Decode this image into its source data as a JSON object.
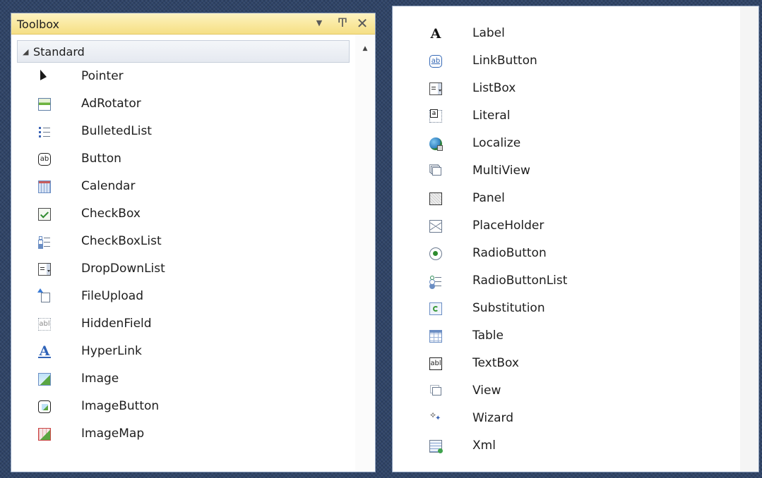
{
  "toolbox": {
    "title": "Toolbox",
    "dropdown_glyph": "▼",
    "pin_glyph": "Ͳ",
    "close_glyph": "✕",
    "scroll_up_glyph": "▲",
    "group": {
      "arrow": "◢",
      "label": "Standard"
    }
  },
  "items_left": [
    {
      "label": "Pointer",
      "icon": "pointer-icon"
    },
    {
      "label": "AdRotator",
      "icon": "adrotator-icon"
    },
    {
      "label": "BulletedList",
      "icon": "bulleted-list-icon"
    },
    {
      "label": "Button",
      "icon": "button-icon"
    },
    {
      "label": "Calendar",
      "icon": "calendar-icon"
    },
    {
      "label": "CheckBox",
      "icon": "checkbox-icon"
    },
    {
      "label": "CheckBoxList",
      "icon": "checkbox-list-icon"
    },
    {
      "label": "DropDownList",
      "icon": "dropdown-list-icon"
    },
    {
      "label": "FileUpload",
      "icon": "file-upload-icon"
    },
    {
      "label": "HiddenField",
      "icon": "hidden-field-icon"
    },
    {
      "label": "HyperLink",
      "icon": "hyperlink-icon"
    },
    {
      "label": "Image",
      "icon": "image-icon"
    },
    {
      "label": "ImageButton",
      "icon": "image-button-icon"
    },
    {
      "label": "ImageMap",
      "icon": "image-map-icon"
    }
  ],
  "items_right": [
    {
      "label": "Label",
      "icon": "label-icon"
    },
    {
      "label": "LinkButton",
      "icon": "link-button-icon"
    },
    {
      "label": "ListBox",
      "icon": "listbox-icon"
    },
    {
      "label": "Literal",
      "icon": "literal-icon"
    },
    {
      "label": "Localize",
      "icon": "localize-icon"
    },
    {
      "label": "MultiView",
      "icon": "multiview-icon"
    },
    {
      "label": "Panel",
      "icon": "panel-icon"
    },
    {
      "label": "PlaceHolder",
      "icon": "placeholder-icon"
    },
    {
      "label": "RadioButton",
      "icon": "radio-button-icon"
    },
    {
      "label": "RadioButtonList",
      "icon": "radio-button-list-icon"
    },
    {
      "label": "Substitution",
      "icon": "substitution-icon"
    },
    {
      "label": "Table",
      "icon": "table-icon"
    },
    {
      "label": "TextBox",
      "icon": "textbox-icon"
    },
    {
      "label": "View",
      "icon": "view-icon"
    },
    {
      "label": "Wizard",
      "icon": "wizard-icon"
    },
    {
      "label": "Xml",
      "icon": "xml-icon"
    }
  ]
}
